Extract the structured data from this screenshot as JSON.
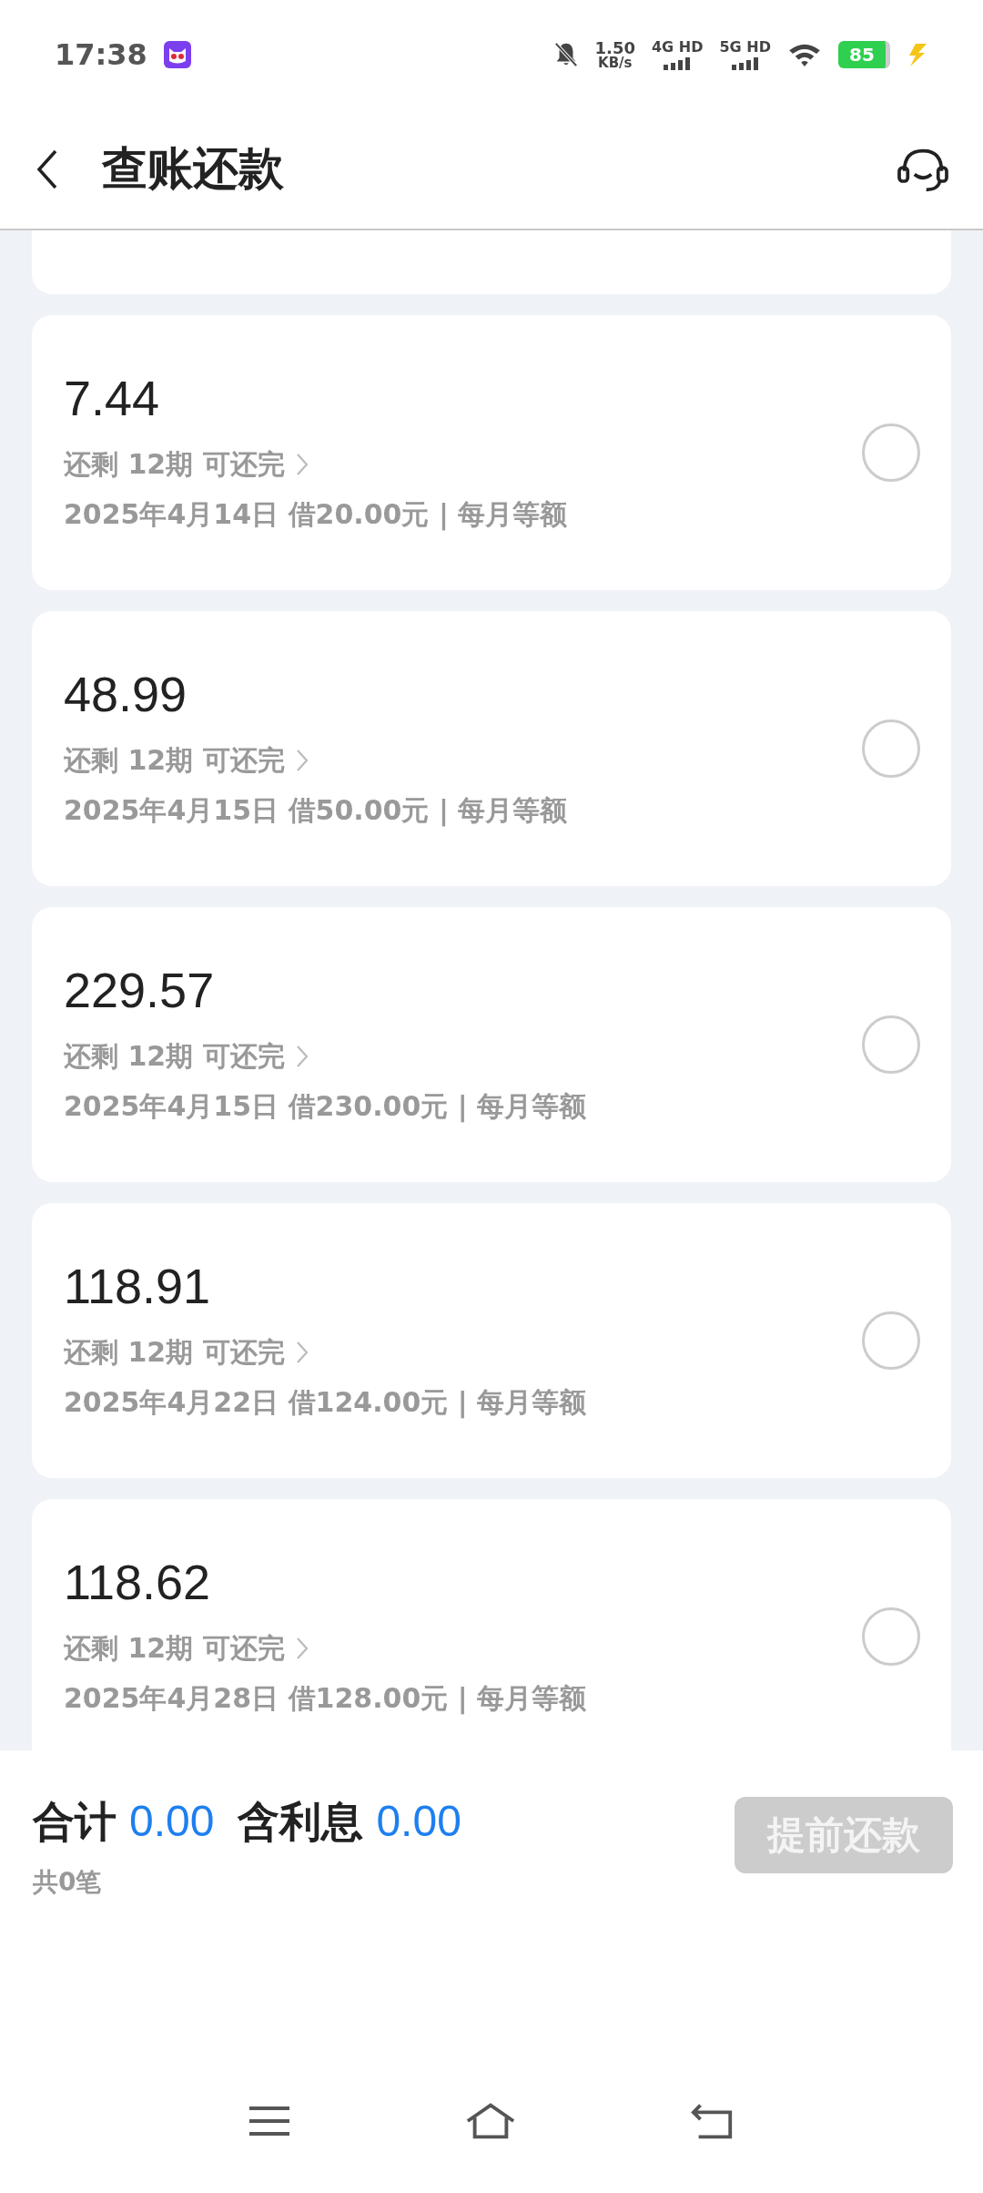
{
  "status_bar": {
    "time": "17:38",
    "speed_value": "1.50",
    "speed_unit": "KB/s",
    "networks": [
      "4G HD",
      "5G HD"
    ],
    "battery": "85"
  },
  "header": {
    "title": "查账还款"
  },
  "loans": [
    {
      "amount": "7.44",
      "remaining": "还剩 12期 可还完",
      "detail": "2025年4月14日 借20.00元 | 每月等额",
      "selected": false
    },
    {
      "amount": "48.99",
      "remaining": "还剩 12期 可还完",
      "detail": "2025年4月15日 借50.00元 | 每月等额",
      "selected": false
    },
    {
      "amount": "229.57",
      "remaining": "还剩 12期 可还完",
      "detail": "2025年4月15日 借230.00元 | 每月等额",
      "selected": false
    },
    {
      "amount": "118.91",
      "remaining": "还剩 12期 可还完",
      "detail": "2025年4月22日 借124.00元 | 每月等额",
      "selected": false
    },
    {
      "amount": "118.62",
      "remaining": "还剩 12期 可还完",
      "detail": "2025年4月28日 借128.00元 | 每月等额",
      "selected": false
    }
  ],
  "footer": {
    "total_label": "合计",
    "total_value": "0.00",
    "interest_label": "含利息",
    "interest_value": "0.00",
    "count": "共0笔",
    "button": {
      "label": "提前还款",
      "disabled": true
    }
  }
}
